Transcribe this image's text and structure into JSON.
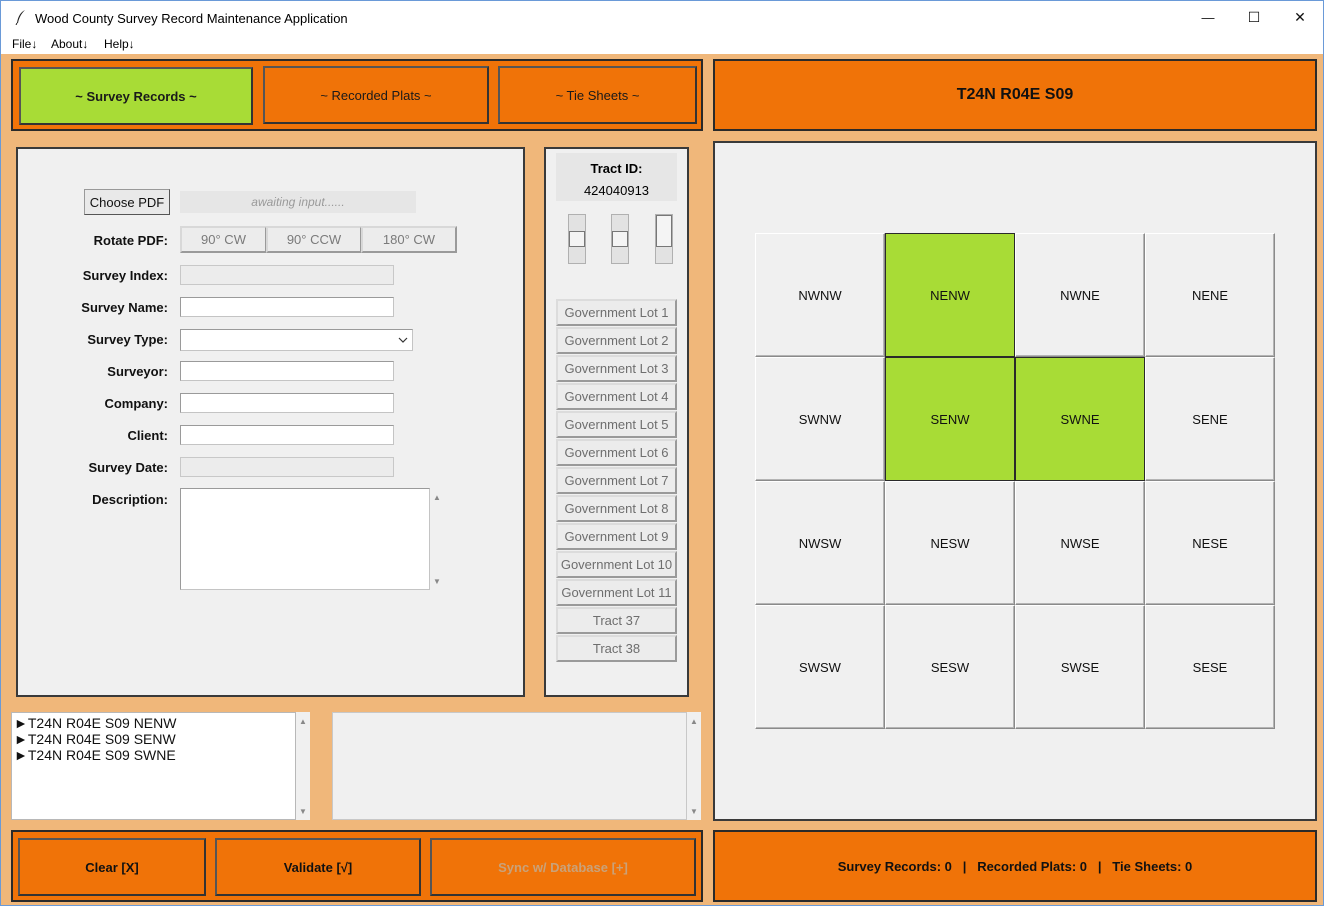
{
  "window": {
    "title": "Wood County Survey Record Maintenance Application",
    "minimize_glyph": "—",
    "maximize_glyph": "☐",
    "close_glyph": "✕"
  },
  "menubar": {
    "items": [
      "File↓",
      "About↓",
      "Help↓"
    ]
  },
  "tabs": {
    "survey_records": "~ Survey Records ~",
    "recorded_plats": "~ Recorded Plats ~",
    "tie_sheets": "~ Tie Sheets ~",
    "active": "survey_records"
  },
  "header": {
    "location": "T24N R04E S09"
  },
  "form": {
    "choose_pdf": "Choose PDF",
    "pdf_status": "awaiting input......",
    "rotate_label": "Rotate PDF:",
    "rotate_options": [
      "90° CW",
      "90° CCW",
      "180° CW"
    ],
    "survey_index_label": "Survey Index:",
    "survey_index_value": "",
    "survey_name_label": "Survey Name:",
    "survey_name_value": "",
    "survey_type_label": "Survey Type:",
    "survey_type_value": "",
    "surveyor_label": "Surveyor:",
    "surveyor_value": "",
    "company_label": "Company:",
    "company_value": "",
    "client_label": "Client:",
    "client_value": "",
    "survey_date_label": "Survey Date:",
    "survey_date_value": "",
    "description_label": "Description:",
    "description_value": ""
  },
  "tract": {
    "label": "Tract ID:",
    "value": "424040913",
    "lots": [
      "Government Lot 1",
      "Government Lot 2",
      "Government Lot 3",
      "Government Lot 4",
      "Government Lot 5",
      "Government Lot 6",
      "Government Lot 7",
      "Government Lot 8",
      "Government Lot 9",
      "Government Lot 10",
      "Government Lot 11",
      "Tract 37",
      "Tract 38"
    ]
  },
  "quarter_grid": {
    "cells": [
      {
        "label": "NWNW",
        "selected": false
      },
      {
        "label": "NENW",
        "selected": true
      },
      {
        "label": "NWNE",
        "selected": false
      },
      {
        "label": "NENE",
        "selected": false
      },
      {
        "label": "SWNW",
        "selected": false
      },
      {
        "label": "SENW",
        "selected": true
      },
      {
        "label": "SWNE",
        "selected": true
      },
      {
        "label": "SENE",
        "selected": false
      },
      {
        "label": "NWSW",
        "selected": false
      },
      {
        "label": "NESW",
        "selected": false
      },
      {
        "label": "NWSE",
        "selected": false
      },
      {
        "label": "NESE",
        "selected": false
      },
      {
        "label": "SWSW",
        "selected": false
      },
      {
        "label": "SESW",
        "selected": false
      },
      {
        "label": "SWSE",
        "selected": false
      },
      {
        "label": "SESE",
        "selected": false
      }
    ],
    "selected_color": "#a8dc36"
  },
  "selection_list": {
    "items": [
      "►T24N R04E S09 NENW",
      "►T24N R04E S09 SENW",
      "►T24N R04E S09 SWNE"
    ]
  },
  "actions": {
    "clear": "Clear [X]",
    "validate": "Validate [√]",
    "sync": "Sync w/ Database [+]"
  },
  "status": {
    "text": "Survey Records: 0   |   Recorded Plats: 0   |   Tie Sheets: 0"
  },
  "colors": {
    "accent_orange": "#f07308",
    "background_peach": "#f0b77a",
    "active_green": "#a8dc36"
  }
}
